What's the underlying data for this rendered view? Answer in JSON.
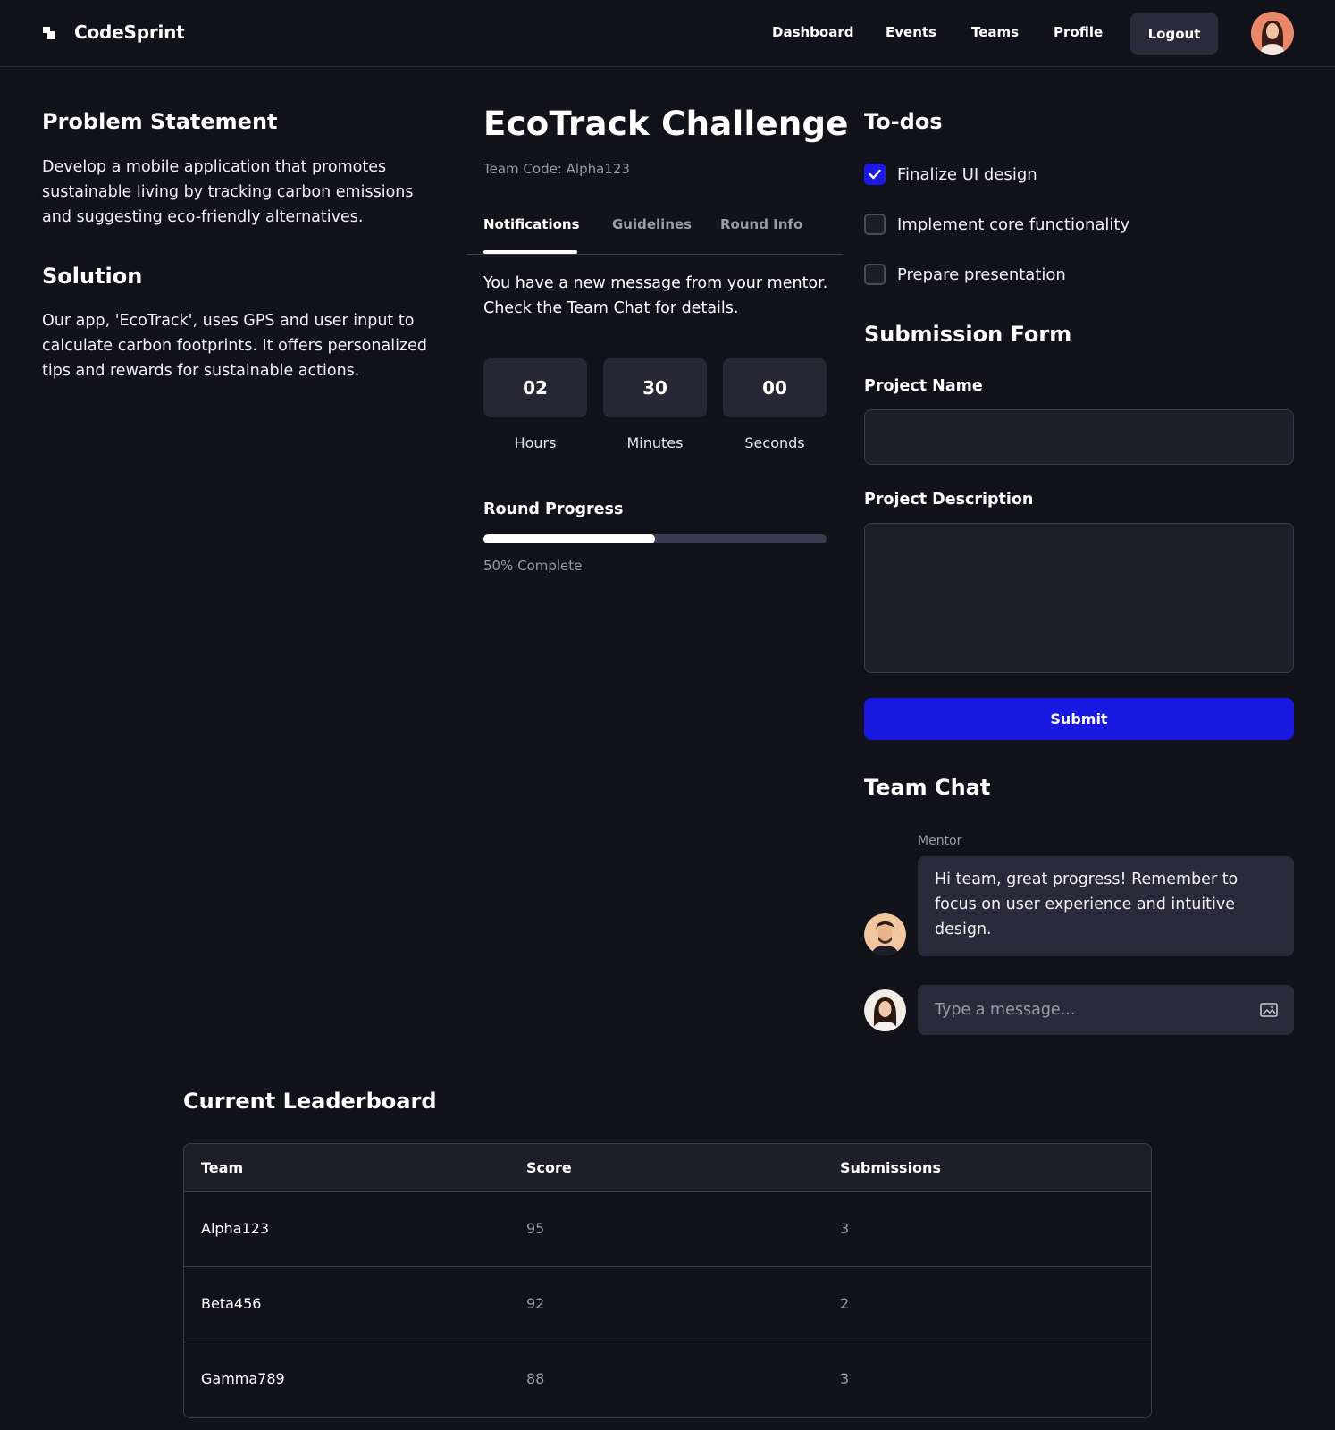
{
  "header": {
    "brand": "CodeSprint",
    "nav": [
      "Dashboard",
      "Events",
      "Teams",
      "Profile"
    ],
    "logout": "Logout"
  },
  "left": {
    "problem_title": "Problem Statement",
    "problem_text": "Develop a mobile application that promotes sustainable living by tracking carbon emissions and suggesting eco-friendly alternatives.",
    "solution_title": "Solution",
    "solution_text": "Our app, 'EcoTrack', uses GPS and user input to calculate carbon footprints. It offers personalized tips and rewards for sustainable actions."
  },
  "middle": {
    "title": "EcoTrack Challenge",
    "team_code": "Team Code: Alpha123",
    "tabs": [
      "Notifications",
      "Guidelines",
      "Round Info"
    ],
    "active_tab": "Notifications",
    "notification": "You have a new message from your mentor. Check the Team Chat for details.",
    "timer": {
      "hours": "02",
      "hours_label": "Hours",
      "minutes": "30",
      "minutes_label": "Minutes",
      "seconds": "00",
      "seconds_label": "Seconds"
    },
    "progress_title": "Round Progress",
    "progress_percent": 50,
    "progress_text": "50% Complete"
  },
  "todos": {
    "title": "To-dos",
    "items": [
      {
        "label": "Finalize UI design",
        "done": true
      },
      {
        "label": "Implement core functionality",
        "done": false
      },
      {
        "label": "Prepare presentation",
        "done": false
      }
    ]
  },
  "form": {
    "title": "Submission Form",
    "name_label": "Project Name",
    "name_value": "",
    "desc_label": "Project Description",
    "desc_value": "",
    "submit": "Submit"
  },
  "chat": {
    "title": "Team Chat",
    "sender": "Mentor",
    "message": "Hi team, great progress! Remember to focus on user experience and intuitive design.",
    "placeholder": "Type a message..."
  },
  "leaderboard": {
    "title": "Current Leaderboard",
    "columns": [
      "Team",
      "Score",
      "Submissions"
    ],
    "rows": [
      {
        "team": "Alpha123",
        "score": "95",
        "submissions": "3"
      },
      {
        "team": "Beta456",
        "score": "92",
        "submissions": "2"
      },
      {
        "team": "Gamma789",
        "score": "88",
        "submissions": "3"
      }
    ]
  },
  "colors": {
    "background": "#12121a",
    "accent": "#1818e0",
    "surface": "#2a2a3a"
  },
  "icons": [
    "brand-logo-icon",
    "check-icon",
    "image-attach-icon",
    "user-avatar",
    "mentor-avatar"
  ]
}
